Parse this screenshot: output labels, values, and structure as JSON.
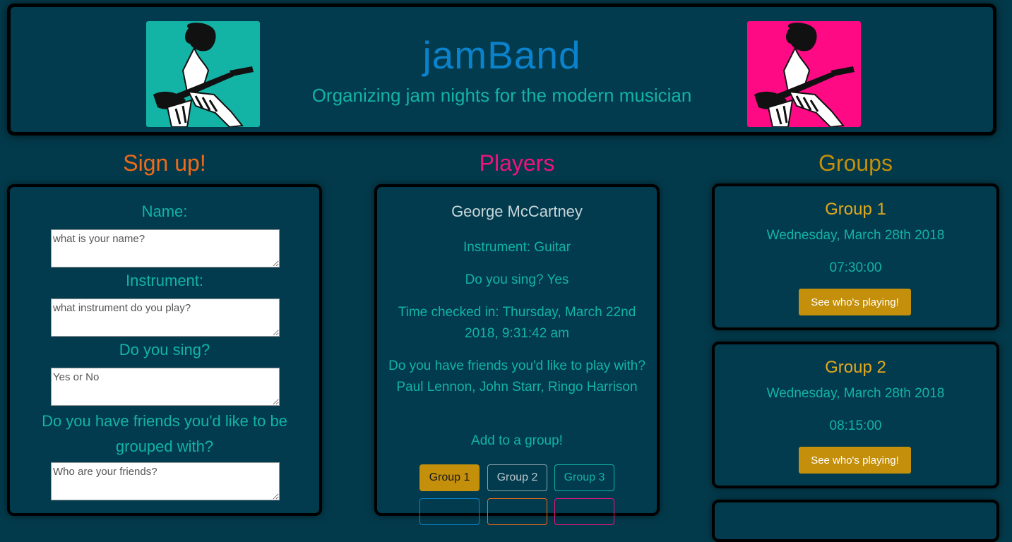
{
  "header": {
    "title": "jamBand",
    "subtitle": "Organizing jam nights for the modern musician",
    "left_image_bg": "#13b3a6",
    "right_image_bg": "#ff0a85"
  },
  "signup": {
    "heading": "Sign up!",
    "heading_color": "#ef6a1a",
    "name_label": "Name:",
    "name_placeholder": "what is your name?",
    "instrument_label": "Instrument:",
    "instrument_placeholder": "what instrument do you play?",
    "sing_label": "Do you sing?",
    "sing_placeholder": "Yes or No",
    "friends_label": "Do you have friends you'd like to be grouped with?",
    "friends_placeholder": "Who are your friends?"
  },
  "players": {
    "heading": "Players",
    "heading_color": "#f0137e",
    "player": {
      "name": "George McCartney",
      "instrument": "Instrument: Guitar",
      "sing": "Do you sing? Yes",
      "checked_in": "Time checked in: Thursday, March 22nd 2018, 9:31:42 am",
      "friends": "Do you have friends you'd like to play with? Paul Lennon, John Starr, Ringo Harrison",
      "add_prompt": "Add to a group!",
      "group_buttons": [
        "Group 1",
        "Group 2",
        "Group 3"
      ]
    }
  },
  "groups": {
    "heading": "Groups",
    "heading_color": "#c48f0a",
    "items": [
      {
        "name": "Group 1",
        "date": "Wednesday, March 28th 2018",
        "time": "07:30:00",
        "button": "See who's playing!"
      },
      {
        "name": "Group 2",
        "date": "Wednesday, March 28th 2018",
        "time": "08:15:00",
        "button": "See who's playing!"
      }
    ]
  }
}
